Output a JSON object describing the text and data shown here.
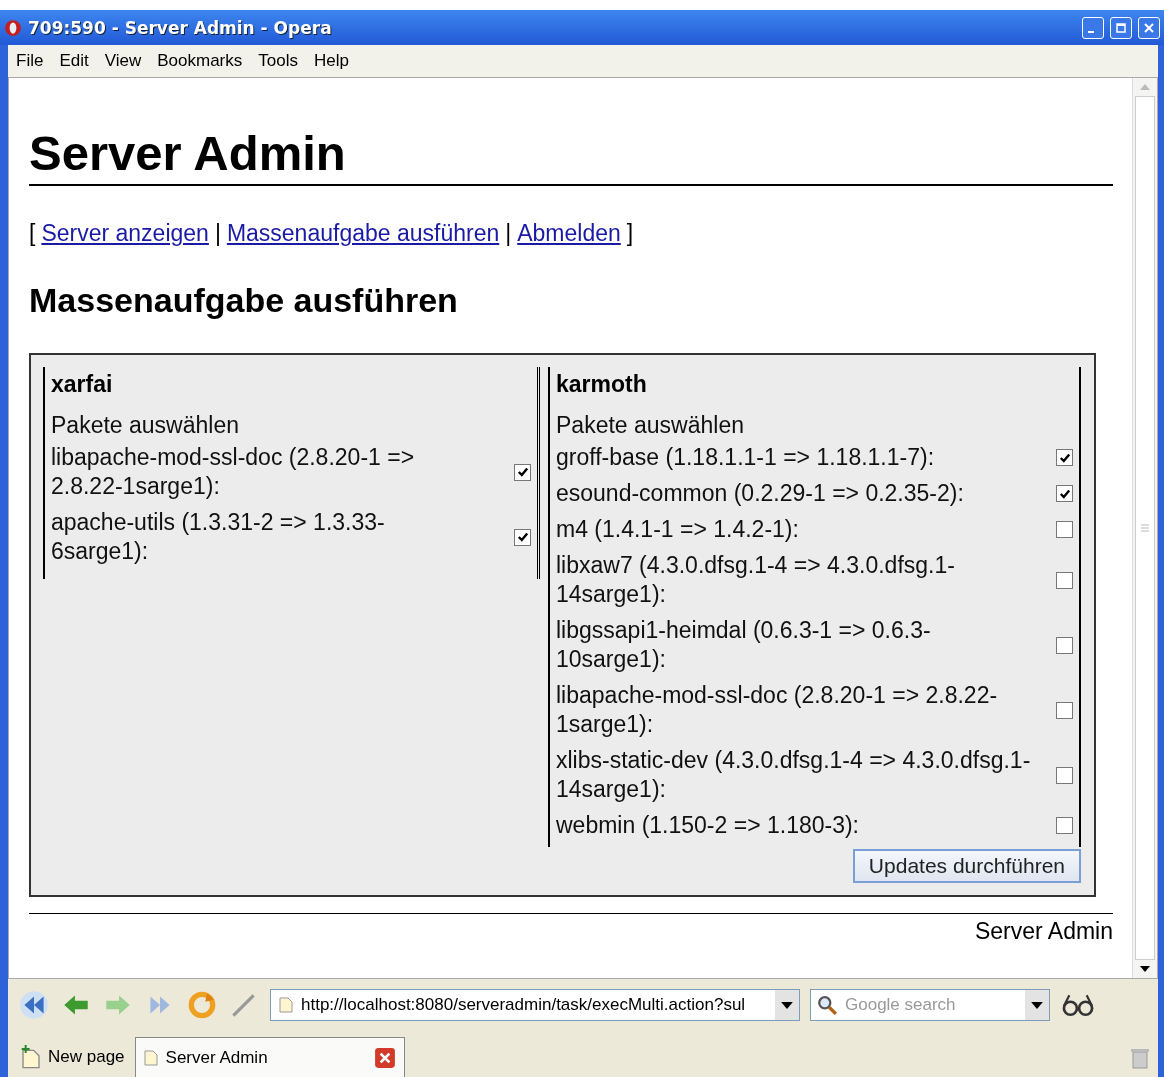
{
  "window": {
    "title": "709:590 - Server Admin - Opera"
  },
  "menu": [
    "File",
    "Edit",
    "View",
    "Bookmarks",
    "Tools",
    "Help"
  ],
  "page": {
    "title": "Server Admin",
    "nav": [
      {
        "kind": "punct",
        "text": "["
      },
      {
        "kind": "link",
        "text": "Server anzeigen"
      },
      {
        "kind": "punct",
        "text": "|"
      },
      {
        "kind": "link",
        "text": "Massenaufgabe ausführen"
      },
      {
        "kind": "punct",
        "text": "|"
      },
      {
        "kind": "link",
        "text": "Abmelden"
      },
      {
        "kind": "punct",
        "text": "]"
      }
    ],
    "heading": "Massenaufgabe ausführen",
    "servers": [
      {
        "name": "xarfai",
        "label": "Pakete auswählen",
        "packages": [
          {
            "name": "libapache-mod-ssl-doc (2.8.20-1 => 2.8.22-1sarge1):",
            "checked": true
          },
          {
            "name": "apache-utils (1.3.31-2 => 1.3.33-6sarge1):",
            "checked": true
          }
        ]
      },
      {
        "name": "karmoth",
        "label": "Pakete auswählen",
        "packages": [
          {
            "name": "groff-base (1.18.1.1-1 => 1.18.1.1-7):",
            "checked": true
          },
          {
            "name": "esound-common (0.2.29-1 => 0.2.35-2):",
            "checked": true
          },
          {
            "name": "m4 (1.4.1-1 => 1.4.2-1):",
            "checked": false
          },
          {
            "name": "libxaw7 (4.3.0.dfsg.1-4 => 4.3.0.dfsg.1-14sarge1):",
            "checked": false
          },
          {
            "name": "libgssapi1-heimdal (0.6.3-1 => 0.6.3-10sarge1):",
            "checked": false
          },
          {
            "name": "libapache-mod-ssl-doc (2.8.20-1 => 2.8.22-1sarge1):",
            "checked": false
          },
          {
            "name": "xlibs-static-dev (4.3.0.dfsg.1-4 => 4.3.0.dfsg.1-14sarge1):",
            "checked": false
          },
          {
            "name": "webmin (1.150-2 => 1.180-3):",
            "checked": false
          }
        ]
      }
    ],
    "button": "Updates durchführen",
    "footer": "Server Admin"
  },
  "toolbar": {
    "address": "http://localhost:8080/serveradmin/task/execMulti.action?sul",
    "search_placeholder": "Google search"
  },
  "new_page_button": "New page",
  "tabs": [
    {
      "label": "Server Admin",
      "selected": true
    }
  ]
}
